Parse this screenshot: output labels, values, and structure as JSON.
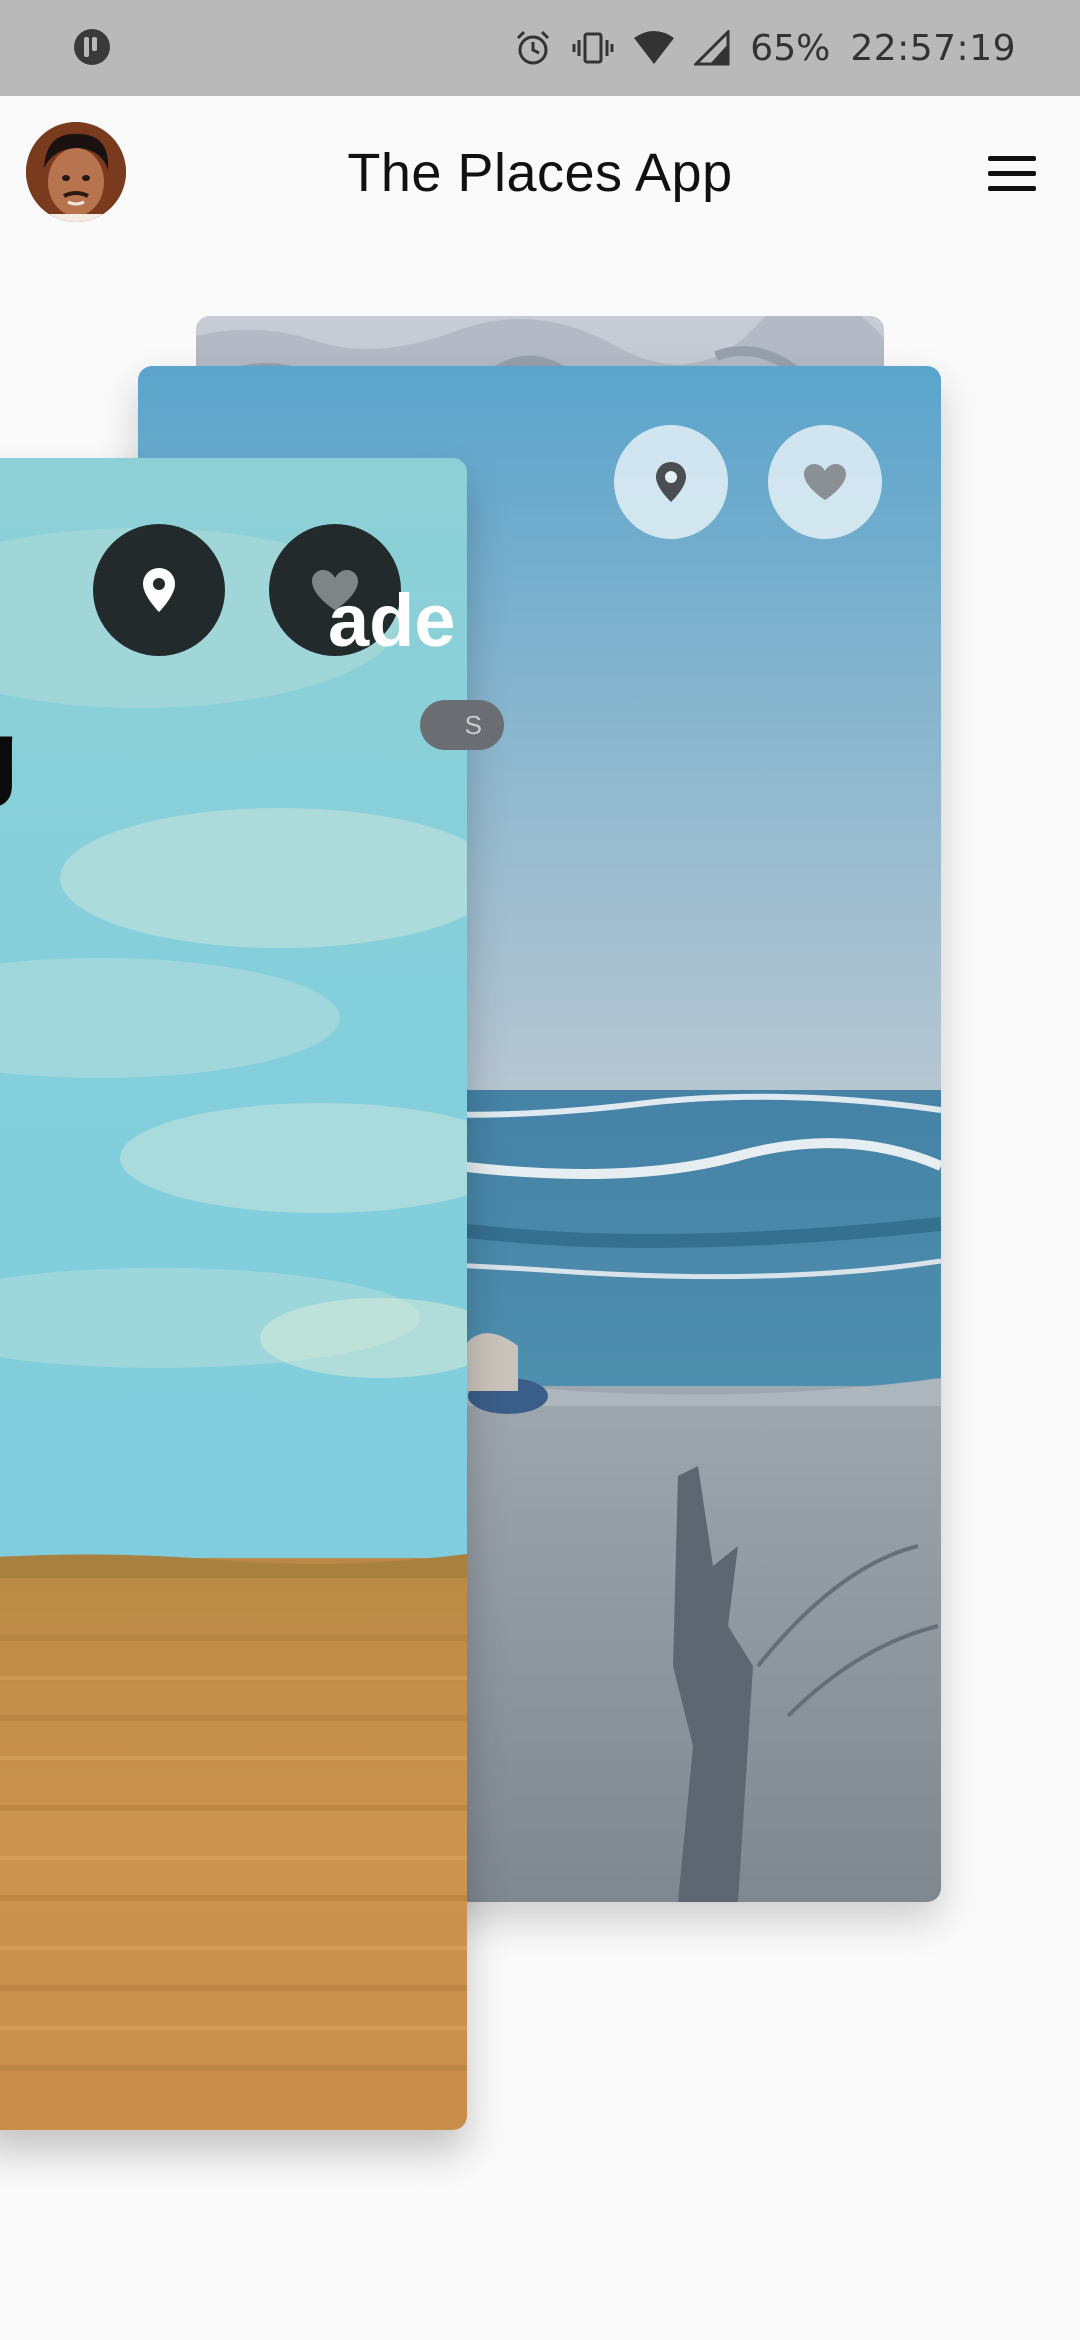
{
  "status_bar": {
    "left_icon": "app-notification-icon",
    "icons": [
      "alarm-icon",
      "vibrate-icon",
      "wifi-icon",
      "cell-signal-icon"
    ],
    "battery": "65%",
    "time": "22:57:19"
  },
  "app_bar": {
    "title": "The Places App",
    "avatar": "user-avatar",
    "menu_icon": "hamburger-menu-icon"
  },
  "cards": {
    "back": {
      "image": "rocky-landscape-photo"
    },
    "middle": {
      "title_visible": "ade",
      "chip_visible": "S",
      "image": "beach-ocean-photo",
      "buttons": [
        "location-pin-icon",
        "heart-icon"
      ]
    },
    "front": {
      "title_visible": "g",
      "image": "wheat-field-sky-photo",
      "buttons": [
        "location-pin-icon",
        "heart-icon"
      ]
    }
  },
  "colors": {
    "status_bar_bg": "#b9b9b9",
    "page_bg": "#fafafa",
    "front_button_bg": "#222a2c",
    "middle_button_bg": "#e4f0f6",
    "sky_front": "#86d3dd",
    "wheat": "#c8924a",
    "ocean": "#3f7e9f",
    "sand": "#8b8f95"
  }
}
